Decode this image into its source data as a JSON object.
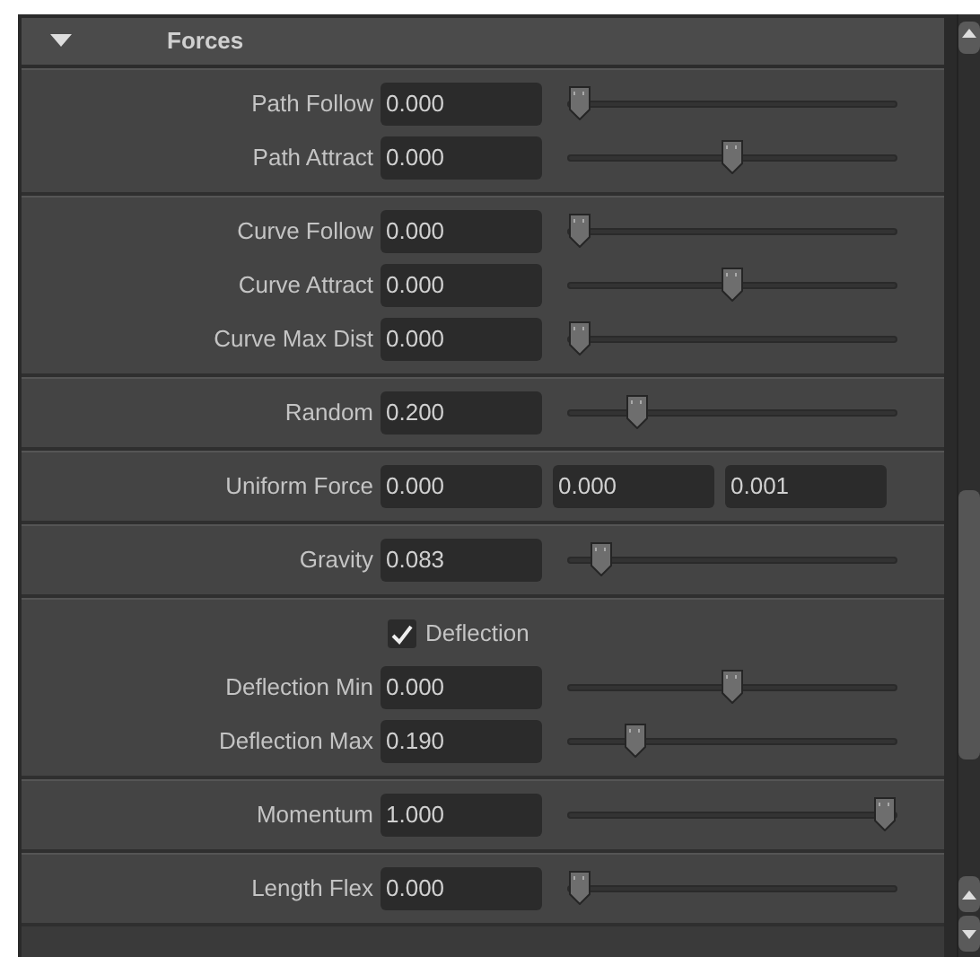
{
  "section": {
    "title": "Forces",
    "expanded": true
  },
  "groups": [
    {
      "rows": [
        {
          "kind": "slider",
          "label": "Path Follow",
          "value": "0.000",
          "level": 0
        },
        {
          "kind": "slider",
          "label": "Path Attract",
          "value": "0.000",
          "level": 0.5
        }
      ]
    },
    {
      "rows": [
        {
          "kind": "slider",
          "label": "Curve Follow",
          "value": "0.000",
          "level": 0
        },
        {
          "kind": "slider",
          "label": "Curve Attract",
          "value": "0.000",
          "level": 0.5
        },
        {
          "kind": "slider",
          "label": "Curve Max Dist",
          "value": "0.000",
          "level": 0
        }
      ]
    },
    {
      "rows": [
        {
          "kind": "slider",
          "label": "Random",
          "value": "0.200",
          "level": 0.19
        }
      ]
    },
    {
      "rows": [
        {
          "kind": "vector",
          "label": "Uniform Force",
          "values": [
            "0.000",
            "0.000",
            "0.001"
          ]
        }
      ]
    },
    {
      "rows": [
        {
          "kind": "slider",
          "label": "Gravity",
          "value": "0.083",
          "level": 0.07
        }
      ]
    },
    {
      "rows": [
        {
          "kind": "checkbox",
          "label": "Deflection",
          "checked": true
        },
        {
          "kind": "slider",
          "label": "Deflection Min",
          "value": "0.000",
          "level": 0.5
        },
        {
          "kind": "slider",
          "label": "Deflection Max",
          "value": "0.190",
          "level": 0.18
        }
      ]
    },
    {
      "rows": [
        {
          "kind": "slider",
          "label": "Momentum",
          "value": "1.000",
          "level": 1
        }
      ]
    },
    {
      "rows": [
        {
          "kind": "slider",
          "label": "Length Flex",
          "value": "0.000",
          "level": 0
        }
      ]
    }
  ]
}
